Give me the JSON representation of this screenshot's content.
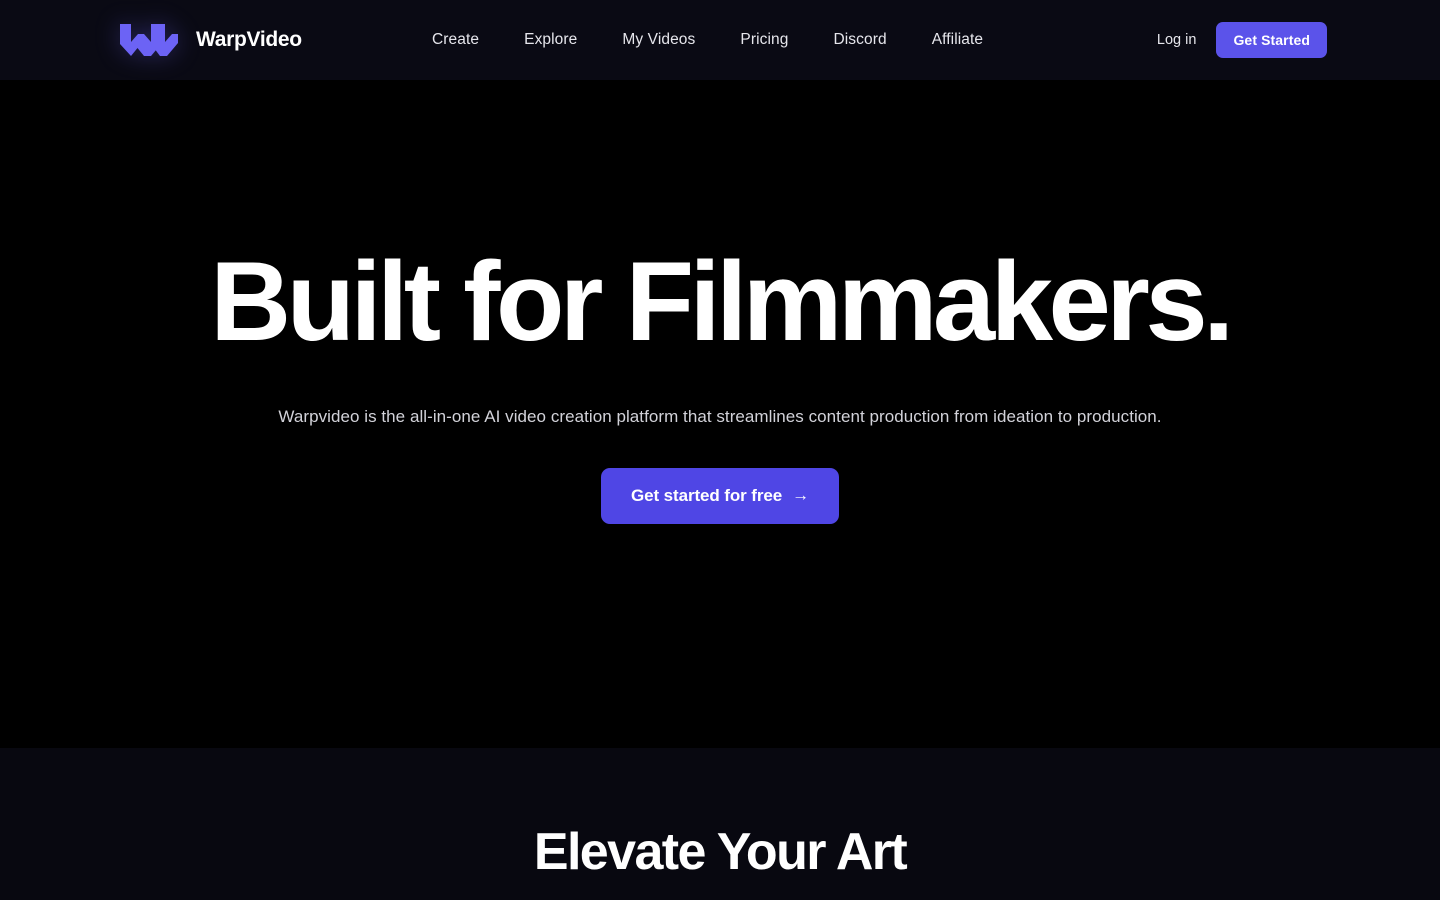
{
  "header": {
    "brand": {
      "name": "WarpVideo",
      "logo_icon": "warp-w-logo-icon",
      "logo_color": "#6c63f5"
    },
    "nav_links": [
      {
        "label": "Create"
      },
      {
        "label": "Explore"
      },
      {
        "label": "My Videos"
      },
      {
        "label": "Pricing"
      },
      {
        "label": "Discord"
      },
      {
        "label": "Affiliate"
      }
    ],
    "login_label": "Log in",
    "get_started_label": "Get Started",
    "background_color": "#0a0a14",
    "accent_color": "#5b53ea"
  },
  "hero": {
    "title": "Built for Filmmakers.",
    "subtitle": "Warpvideo is the all-in-one AI video creation platform that streamlines content production from ideation to production.",
    "cta_label": "Get started for free",
    "cta_arrow_icon": "arrow-right-icon",
    "cta_arrow_glyph": "→",
    "cta_color": "#4f46e5",
    "background_color": "#000000"
  },
  "section_two": {
    "title": "Elevate Your Art",
    "subtitle": "",
    "background_color": "#080810"
  }
}
